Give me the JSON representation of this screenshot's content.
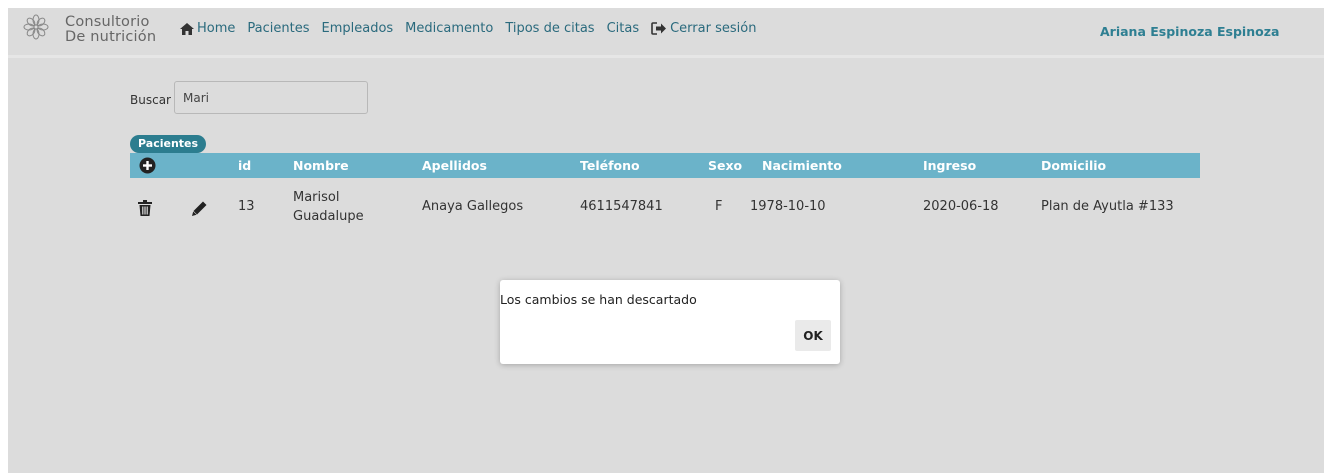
{
  "brand": {
    "line1": "Consultorio",
    "line2": "De nutrición"
  },
  "nav": {
    "home": "Home",
    "pacientes": "Pacientes",
    "empleados": "Empleados",
    "medicamento": "Medicamento",
    "tipos_citas": "Tipos de citas",
    "citas": "Citas",
    "logout": "Cerrar sesión"
  },
  "user": {
    "name": "Ariana Espinoza Espinoza"
  },
  "search": {
    "label": "Buscar",
    "value": "Mari"
  },
  "table": {
    "badge": "Pacientes",
    "headers": {
      "id": "id",
      "nombre": "Nombre",
      "apellidos": "Apellidos",
      "telefono": "Teléfono",
      "sexo": "Sexo",
      "nacimiento": "Nacimiento",
      "ingreso": "Ingreso",
      "domicilio": "Domicilio"
    },
    "rows": [
      {
        "id": "13",
        "nombre_1": "Marisol",
        "nombre_2": "Guadalupe",
        "apellidos": "Anaya Gallegos",
        "telefono": "4611547841",
        "sexo": "F",
        "nacimiento": "1978-10-10",
        "ingreso": "2020-06-18",
        "domicilio": "Plan de Ayutla #133"
      }
    ]
  },
  "dialog": {
    "message": "Los cambios se han descartado",
    "ok_label": "OK"
  },
  "colors": {
    "page_bg": "#dcdcdc",
    "header_bg": "#6bb3c9",
    "badge_bg": "#2c7d8f",
    "nav_text": "#2a6a7d",
    "user_text": "#2e7f92"
  },
  "icons": {
    "logo": "flower-logo-icon",
    "home": "home-icon",
    "logout": "sign-out-icon",
    "add": "plus-circle-icon",
    "delete": "trash-icon",
    "edit": "pencil-icon"
  }
}
